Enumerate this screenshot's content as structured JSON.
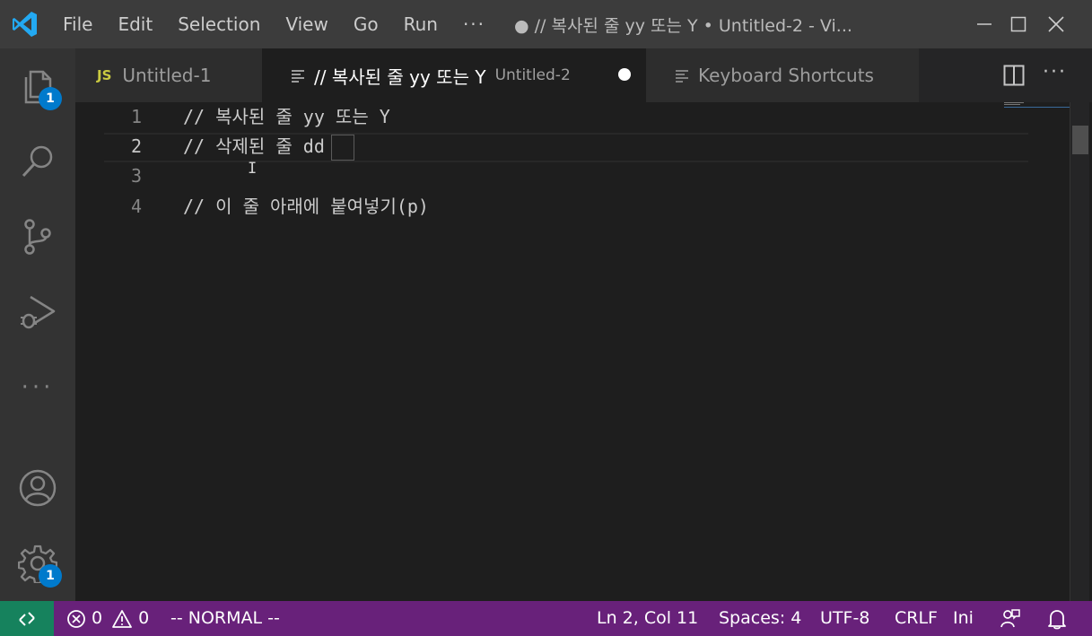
{
  "titlebar": {
    "menu": [
      "File",
      "Edit",
      "Selection",
      "View",
      "Go",
      "Run"
    ],
    "more": "···",
    "title": "● // 복사된 줄 yy 또는 Y • Untitled-2 - Vi..."
  },
  "activitybar": {
    "explorer_badge": "1",
    "settings_badge": "1"
  },
  "tabs": [
    {
      "icon": "JS",
      "label": "Untitled-1",
      "active": false
    },
    {
      "label": "// 복사된 줄 yy 또는 Y",
      "desc": "Untitled-2",
      "active": true,
      "dirty": true
    },
    {
      "label": "Keyboard Shortcuts",
      "active": false
    }
  ],
  "editor": {
    "lines": [
      {
        "num": "1",
        "text": "// 복사된 줄 yy 또는 Y"
      },
      {
        "num": "2",
        "text": "// 삭제된 줄 dd"
      },
      {
        "num": "3",
        "text": ""
      },
      {
        "num": "4",
        "text": "// 이 줄 아래에 붙여넣기(p)"
      }
    ],
    "current_line": 2
  },
  "statusbar": {
    "errors": "0",
    "warnings": "0",
    "mode": "-- NORMAL --",
    "position": "Ln 2, Col 11",
    "spaces": "Spaces: 4",
    "encoding": "UTF-8",
    "eol": "CRLF",
    "language": "Ini"
  },
  "colors": {
    "statusbar": "#68217a",
    "remote": "#16825d",
    "badge": "#007acc",
    "titlebar": "#3c3c3c",
    "activitybar": "#333333"
  }
}
